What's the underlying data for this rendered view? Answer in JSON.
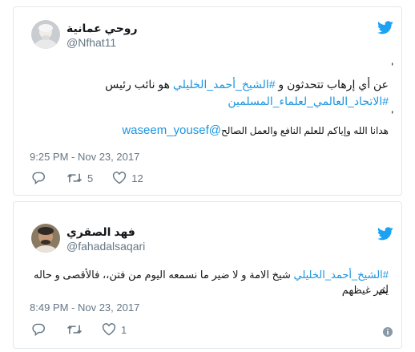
{
  "tweets": [
    {
      "name": "روحي عمانية",
      "handle": "@Nfhat11",
      "stray_top": "'",
      "line1_prefix": "عن أي إرهاب تتحدثون و ",
      "line1_hashtag": "#الشيخ_أحمد_الخليلي",
      "line1_suffix": " هو نائب رئيس",
      "line2_hashtag": "#الاتحاد_العالمي_لعلماء_المسلمين",
      "stray_bottom": "'",
      "line3_text": "هدانا الله وإياكم للعلم النافع والعمل الصالح",
      "line3_mention": "@waseem_yousef",
      "timestamp": "9:25 PM - Nov 23, 2017",
      "retweets": "5",
      "likes": "12"
    },
    {
      "name": "فهد الصقري",
      "handle": "@fahadalsaqari",
      "line1_hashtag": "#الشيخ_أحمد_الخليلي",
      "line1_suffix": " شيخ الامة و لا ضير ما نسمعه اليوم من فتن،، فالأقصى و حاله لم",
      "line2_text": "يثير غيظهم",
      "timestamp": "8:49 PM - Nov 23, 2017",
      "likes": "1"
    }
  ],
  "colors": {
    "brand": "#1da1f2",
    "link": "#1b95e0",
    "muted": "#657786",
    "border": "#e1e8ed"
  },
  "icons": [
    "twitter-bird-icon",
    "reply-icon",
    "retweet-icon",
    "like-icon",
    "info-icon"
  ]
}
